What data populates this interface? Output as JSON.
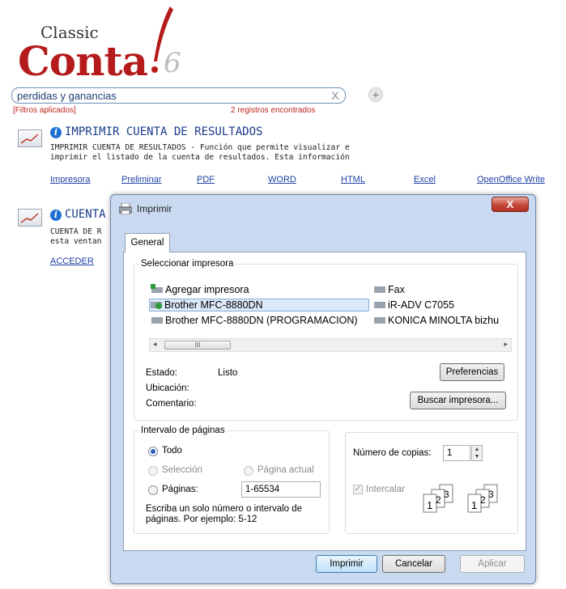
{
  "logo": {
    "line1": "Classic",
    "line2": "Conta",
    "version": "6"
  },
  "search": {
    "value": "perdidas y ganancias",
    "clear": "X",
    "add": "+"
  },
  "filters_label": "[Filtros aplicados]",
  "results_count": "2 registros encontrados",
  "results": [
    {
      "title": "IMPRIMIR CUENTA DE RESULTADOS",
      "desc_line1": "IMPRIMIR CUENTA DE RESULTADOS - Función que permite visualizar e",
      "desc_line2": "imprimir el listado de la cuenta de resultados. Esta información",
      "links": [
        "Impresora",
        "Preliminar",
        "PDF",
        "WORD",
        "HTML",
        "Excel",
        "OpenOffice Write"
      ]
    },
    {
      "title": "CUENTA",
      "desc_line1": "CUENTA DE R",
      "desc_line2": "esta ventan",
      "links": [
        "ACCEDER"
      ]
    }
  ],
  "dialog": {
    "title": "Imprimir",
    "close": "X",
    "tab": "General",
    "select_printer_legend": "Seleccionar impresora",
    "printers_left": [
      "Agregar impresora",
      "Brother MFC-8880DN",
      "Brother MFC-8880DN (PROGRAMACION)"
    ],
    "printers_right": [
      "Fax",
      "iR-ADV C7055",
      "KONICA MINOLTA bizhu"
    ],
    "selected_printer": "Brother MFC-8880DN",
    "status_label": "Estado:",
    "status_value": "Listo",
    "location_label": "Ubicación:",
    "comment_label": "Comentario:",
    "preferences_button": "Preferencias",
    "find_printer_button": "Buscar impresora...",
    "page_range_legend": "Intervalo de páginas",
    "range_all": "Todo",
    "range_selection": "Selección",
    "range_current": "Página actual",
    "range_pages": "Páginas:",
    "pages_value": "1-65534",
    "pages_hint": "Escriba un solo número o intervalo de páginas. Por ejemplo: 5-12",
    "copies_label": "Número de copias:",
    "copies_value": "1",
    "collate_label": "Intercalar",
    "print_button": "Imprimir",
    "cancel_button": "Cancelar",
    "apply_button": "Aplicar",
    "scroll_grip": "III"
  }
}
